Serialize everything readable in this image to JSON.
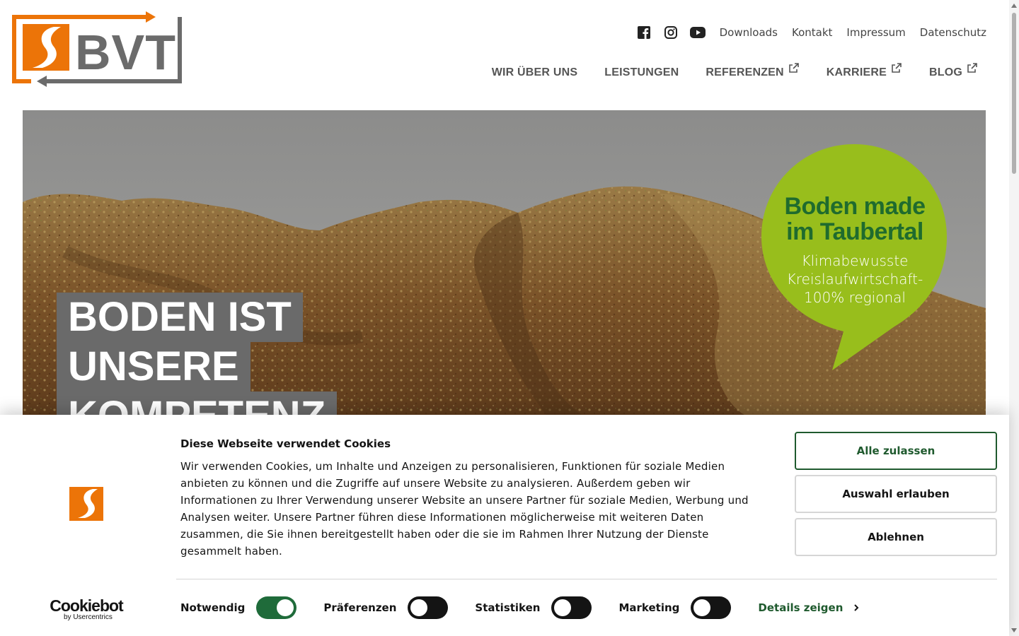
{
  "brand": {
    "name": "BVT",
    "colors": {
      "orange": "#ec7408",
      "gray": "#6b6b6b",
      "green": "#98be1c",
      "darkgreen": "#1f6b2e"
    }
  },
  "topbar": {
    "social": [
      {
        "icon": "facebook-icon"
      },
      {
        "icon": "instagram-icon"
      },
      {
        "icon": "youtube-icon"
      }
    ],
    "links": [
      "Downloads",
      "Kontakt",
      "Impressum",
      "Datenschutz"
    ]
  },
  "nav": [
    {
      "label": "WIR ÜBER UNS",
      "external": false
    },
    {
      "label": "LEISTUNGEN",
      "external": false
    },
    {
      "label": "REFERENZEN",
      "external": true
    },
    {
      "label": "KARRIERE",
      "external": true
    },
    {
      "label": "BLOG",
      "external": true
    }
  ],
  "hero": {
    "headline": [
      "BODEN IST",
      "UNSERE",
      "KOMPETENZ"
    ],
    "bubble": {
      "title_1": "Boden made",
      "title_2": "im Taubertal",
      "sub_1": "Klimabewusste",
      "sub_2": "Kreislaufwirtschaft-",
      "sub_3": "100% regional"
    }
  },
  "cookie": {
    "title": "Diese Webseite verwendet Cookies",
    "text": "Wir verwenden Cookies, um Inhalte und Anzeigen zu personalisieren, Funktionen für soziale Medien anbieten zu können und die Zugriffe auf unsere Website zu analysieren. Außerdem geben wir Informationen zu Ihrer Verwendung unserer Website an unsere Partner für soziale Medien, Werbung und Analysen weiter. Unsere Partner führen diese Informationen möglicherweise mit weiteren Daten zusammen, die Sie ihnen bereitgestellt haben oder die sie im Rahmen Ihrer Nutzung der Dienste gesammelt haben.",
    "buttons": {
      "allow_all": "Alle zulassen",
      "allow_selection": "Auswahl erlauben",
      "deny": "Ablehnen"
    },
    "toggles": [
      {
        "label": "Notwendig",
        "on": true
      },
      {
        "label": "Präferenzen",
        "on": false
      },
      {
        "label": "Statistiken",
        "on": false
      },
      {
        "label": "Marketing",
        "on": false
      }
    ],
    "details": "Details zeigen",
    "provider": {
      "name": "Cookiebot",
      "by": "by Usercentrics"
    }
  }
}
